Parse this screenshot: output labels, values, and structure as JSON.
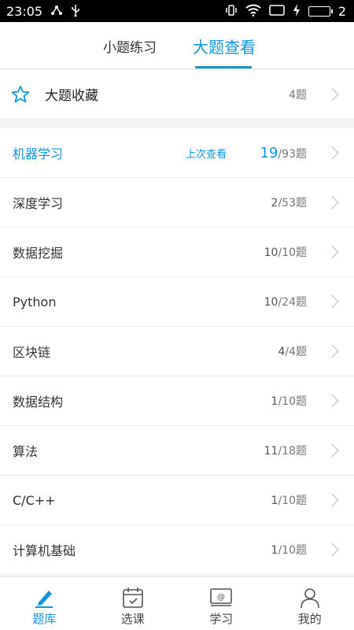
{
  "status": {
    "time": "23:05",
    "battery": "2"
  },
  "tabs": [
    {
      "label": "小题练习"
    },
    {
      "label": "大题查看"
    }
  ],
  "favorites": {
    "label": "大题收藏",
    "count": "4题"
  },
  "list": [
    {
      "label": "机器学习",
      "last": "上次查看",
      "num": "19",
      "rest": "/93题"
    },
    {
      "label": "深度学习",
      "num": "2",
      "rest": "/53题"
    },
    {
      "label": "数据挖掘",
      "num": "10",
      "rest": "/10题"
    },
    {
      "label": "Python",
      "num": "10",
      "rest": "/24题"
    },
    {
      "label": "区块链",
      "num": "4",
      "rest": "/4题"
    },
    {
      "label": "数据结构",
      "num": "1",
      "rest": "/10题"
    },
    {
      "label": "算法",
      "num": "11",
      "rest": "/18题"
    },
    {
      "label": "C/C++",
      "num": "1",
      "rest": "/10题"
    },
    {
      "label": "计算机基础",
      "num": "1",
      "rest": "/10题"
    }
  ],
  "nav": [
    {
      "label": "题库",
      "icon": "pencil-icon"
    },
    {
      "label": "选课",
      "icon": "calendar-icon"
    },
    {
      "label": "学习",
      "icon": "monitor-icon"
    },
    {
      "label": "我的",
      "icon": "user-icon"
    }
  ],
  "colors": {
    "accent": "#1296db"
  }
}
